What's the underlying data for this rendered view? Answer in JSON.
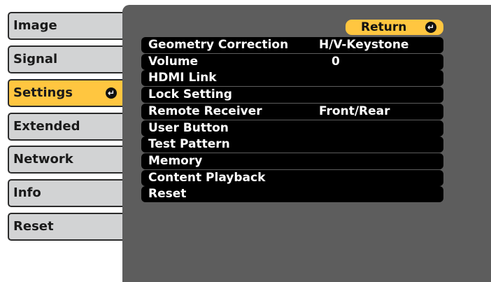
{
  "sidebar": {
    "tabs": [
      {
        "label": "Image",
        "active": false
      },
      {
        "label": "Signal",
        "active": false
      },
      {
        "label": "Settings",
        "active": true
      },
      {
        "label": "Extended",
        "active": false
      },
      {
        "label": "Network",
        "active": false
      },
      {
        "label": "Info",
        "active": false
      },
      {
        "label": "Reset",
        "active": false
      }
    ],
    "enter_glyph": "↵"
  },
  "main": {
    "return_label": "Return",
    "enter_glyph": "↵",
    "items": [
      {
        "label": "Geometry Correction",
        "value": "H/V-Keystone"
      },
      {
        "label": "Volume",
        "value": "0"
      },
      {
        "label": "HDMI Link",
        "value": ""
      },
      {
        "label": "Lock Setting",
        "value": ""
      },
      {
        "label": "Remote Receiver",
        "value": "Front/Rear"
      },
      {
        "label": "User Button",
        "value": ""
      },
      {
        "label": "Test Pattern",
        "value": ""
      },
      {
        "label": "Memory",
        "value": ""
      },
      {
        "label": "Content Playback",
        "value": ""
      },
      {
        "label": "Reset",
        "value": ""
      }
    ]
  },
  "colors": {
    "active_tab": "#ffc640",
    "inactive_tab": "#d2d3d4",
    "panel_background": "#5d5d5d",
    "row_background": "#000000"
  }
}
